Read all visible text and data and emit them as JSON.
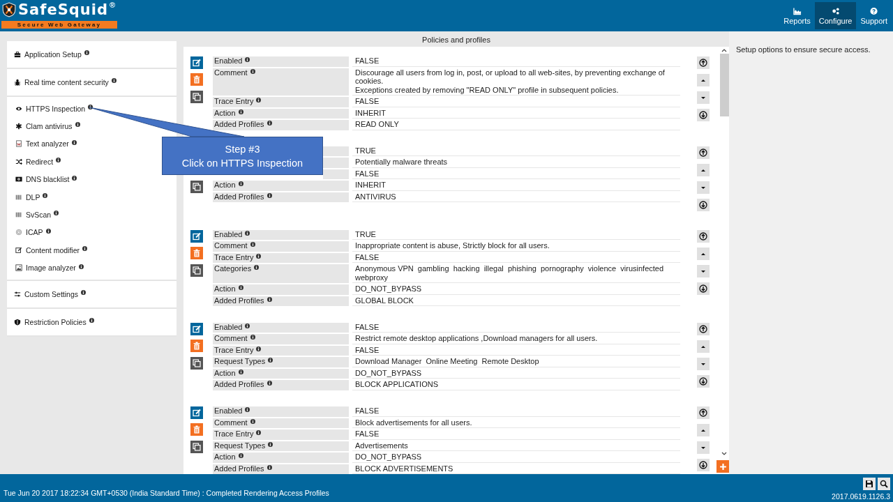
{
  "header": {
    "logo": {
      "name": "SafeSquid",
      "mark": "®",
      "tagline": "Secure Web Gateway"
    },
    "nav": [
      {
        "label": "Reports",
        "selected": false
      },
      {
        "label": "Configure",
        "selected": true
      },
      {
        "label": "Support",
        "selected": false
      }
    ]
  },
  "sidebar": {
    "sections": [
      {
        "items": [
          {
            "label": "Application Setup"
          }
        ]
      },
      {
        "items": [
          {
            "label": "Real time content security"
          }
        ]
      },
      {
        "items": [
          {
            "label": "HTTPS Inspection"
          },
          {
            "label": "Clam antivirus"
          },
          {
            "label": "Text analyzer"
          },
          {
            "label": "Redirect"
          },
          {
            "label": "DNS blacklist"
          },
          {
            "label": "DLP"
          },
          {
            "label": "SvScan"
          },
          {
            "label": "ICAP"
          },
          {
            "label": "Content modifier"
          },
          {
            "label": "Image analyzer"
          }
        ]
      },
      {
        "items": [
          {
            "label": "Custom Settings"
          }
        ]
      },
      {
        "items": [
          {
            "label": "Restriction Policies"
          }
        ]
      }
    ]
  },
  "main": {
    "title": "Policies and profiles",
    "policies": [
      {
        "actions": [
          {
            "kind": "edit"
          },
          {
            "kind": "delete"
          },
          {
            "kind": "copy"
          }
        ],
        "fields": [
          {
            "label": "Enabled",
            "value": "FALSE"
          },
          {
            "label": "Comment",
            "value": "Discourage all users from log in, post, or upload to all web-sites, by preventing exchange of cookies.\nExceptions created by removing \"READ ONLY\" profile in subsequent policies."
          },
          {
            "label": "Trace Entry",
            "value": "FALSE"
          },
          {
            "label": "Action",
            "value": "INHERIT"
          },
          {
            "label": "Added Profiles",
            "value": "READ ONLY"
          }
        ]
      },
      {
        "actions": [
          {
            "kind": "copy"
          }
        ],
        "fields": [
          {
            "value": "TRUE"
          },
          {
            "value": "Potentially malware threats"
          },
          {
            "value": "FALSE"
          },
          {
            "label": "Action",
            "value": "INHERIT"
          },
          {
            "label": "Added Profiles",
            "value": "ANTIVIRUS"
          }
        ]
      },
      {
        "actions": [
          {
            "kind": "edit"
          },
          {
            "kind": "delete"
          },
          {
            "kind": "copy"
          }
        ],
        "fields": [
          {
            "label": "Enabled",
            "value": "TRUE"
          },
          {
            "label": "Comment",
            "value": "Inappropriate content is abuse, Strictly block for all users."
          },
          {
            "label": "Trace Entry",
            "value": "FALSE"
          },
          {
            "label": "Categories",
            "value": "Anonymous VPN  gambling  hacking  illegal  phishing  pornography  violence  virusinfected  webproxy"
          },
          {
            "label": "Action",
            "value": "DO_NOT_BYPASS"
          },
          {
            "label": "Added Profiles",
            "value": "GLOBAL BLOCK"
          }
        ]
      },
      {
        "actions": [
          {
            "kind": "edit"
          },
          {
            "kind": "delete"
          },
          {
            "kind": "copy"
          }
        ],
        "fields": [
          {
            "label": "Enabled",
            "value": "FALSE"
          },
          {
            "label": "Comment",
            "value": "Restrict remote desktop applications ,Download managers for all users."
          },
          {
            "label": "Trace Entry",
            "value": "FALSE"
          },
          {
            "label": "Request Types",
            "value": "Download Manager  Online Meeting  Remote Desktop"
          },
          {
            "label": "Action",
            "value": "DO_NOT_BYPASS"
          },
          {
            "label": "Added Profiles",
            "value": "BLOCK APPLICATIONS"
          }
        ]
      },
      {
        "actions": [
          {
            "kind": "edit"
          },
          {
            "kind": "delete"
          },
          {
            "kind": "copy"
          }
        ],
        "fields": [
          {
            "label": "Enabled",
            "value": "FALSE"
          },
          {
            "label": "Comment",
            "value": "Block advertisements for all users."
          },
          {
            "label": "Trace Entry",
            "value": "FALSE"
          },
          {
            "label": "Request Types",
            "value": "Advertisements"
          },
          {
            "label": "Action",
            "value": "DO_NOT_BYPASS"
          },
          {
            "label": "Added Profiles",
            "value": "BLOCK ADVERTISEMENTS"
          }
        ]
      }
    ]
  },
  "help": {
    "text": "Setup options to ensure secure access."
  },
  "callout": {
    "title": "Step #3",
    "text": "Click on HTTPS Inspection"
  },
  "status_bar": {
    "message": "Tue Jun 20 2017 18:22:34 GMT+0530 (India Standard Time) : Completed Rendering Access Profiles",
    "version": "2017.0619.1126.3"
  }
}
